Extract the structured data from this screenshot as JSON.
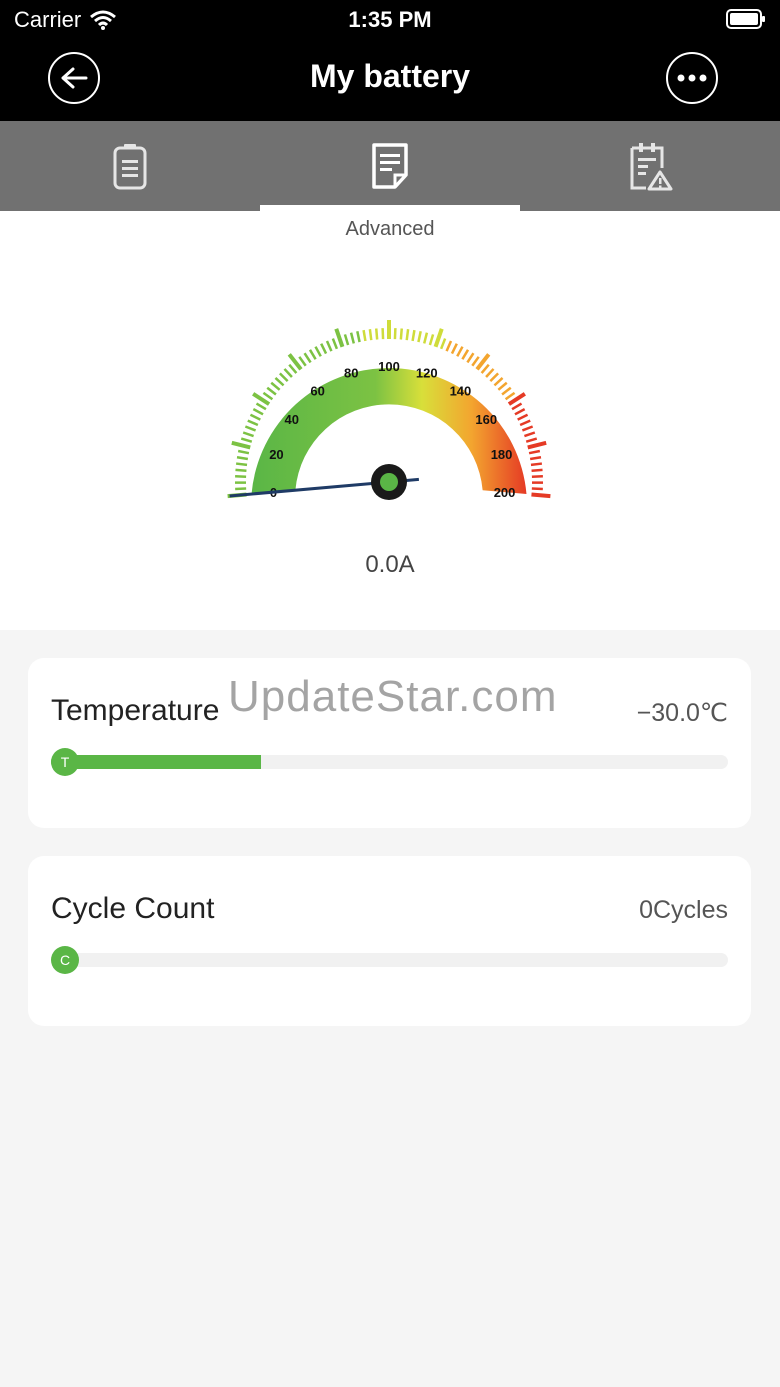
{
  "status": {
    "carrier": "Carrier",
    "time": "1:35 PM"
  },
  "nav": {
    "title": "My battery",
    "back_icon": "back-arrow-icon",
    "more_icon": "more-dots-icon"
  },
  "tabs": [
    {
      "icon": "battery-icon",
      "active": false
    },
    {
      "icon": "document-icon",
      "active": true,
      "caption": "Advanced"
    },
    {
      "icon": "alert-document-icon",
      "active": false
    }
  ],
  "gauge": {
    "ticks": [
      "0",
      "20",
      "40",
      "60",
      "80",
      "100",
      "120",
      "140",
      "160",
      "180",
      "200"
    ],
    "value": 0.0,
    "min": 0,
    "max": 200,
    "readout": "0.0A"
  },
  "cards": {
    "temperature": {
      "label": "Temperature",
      "value": "−30.0℃",
      "knob": "T",
      "fill_fraction": 0.31
    },
    "cycle": {
      "label": "Cycle Count",
      "value": "0Cycles",
      "knob": "C",
      "fill_fraction": 0.0
    }
  },
  "watermark": "UpdateStar.com",
  "colors": {
    "accent": "#5ab646",
    "tab_bg": "#717171",
    "header_bg": "#000000"
  }
}
